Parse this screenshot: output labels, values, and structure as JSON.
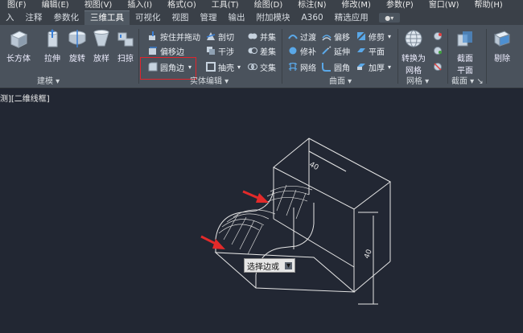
{
  "menu": [
    "图(F)",
    "编辑(E)",
    "视图(V)",
    "插入(I)",
    "格式(O)",
    "工具(T)",
    "绘图(D)",
    "标注(N)",
    "修改(M)",
    "参数(P)",
    "窗口(W)",
    "帮助(H)"
  ],
  "tabs": [
    "入",
    "注释",
    "参数化",
    "三维工具",
    "可视化",
    "视图",
    "管理",
    "输出",
    "附加模块",
    "A360",
    "精选应用"
  ],
  "active_tab": "三维工具",
  "ribbon": {
    "modeling": {
      "box": "长方体",
      "extrude": "拉伸",
      "revolve": "旋转",
      "loft": "放样",
      "sweep": "扫掠",
      "panel": "建模"
    },
    "solid_edit": {
      "presspull": "按住并拖动",
      "offset_edge": "偏移边",
      "fillet_edge": "圆角边",
      "slice": "剖切",
      "interfere": "干涉",
      "shell": "抽壳",
      "union": "并集",
      "subtract": "差集",
      "intersect": "交集",
      "panel": "实体编辑"
    },
    "surface": {
      "blend": "过渡",
      "patch": "修补",
      "network": "网络",
      "offset": "偏移",
      "extend": "延伸",
      "fillet": "圆角",
      "trim": "修剪",
      "planar": "平面",
      "thicken": "加厚",
      "panel": "曲面"
    },
    "mesh": {
      "convert": "转换为",
      "convert2": "网格",
      "panel": "网格"
    },
    "section": {
      "plane": "截面",
      "plane2": "平面",
      "panel": "截面"
    },
    "delete": "剔除"
  },
  "viewport_label": "测][二维线框]",
  "dimensions": {
    "top": "40",
    "side": "40"
  },
  "tooltip": "选择边或",
  "colors": {
    "annotation_arrow": "#e32a2a",
    "highlight_box": "#e2242c",
    "drawing_lines": "#e6e6e6",
    "background": "#222733"
  }
}
